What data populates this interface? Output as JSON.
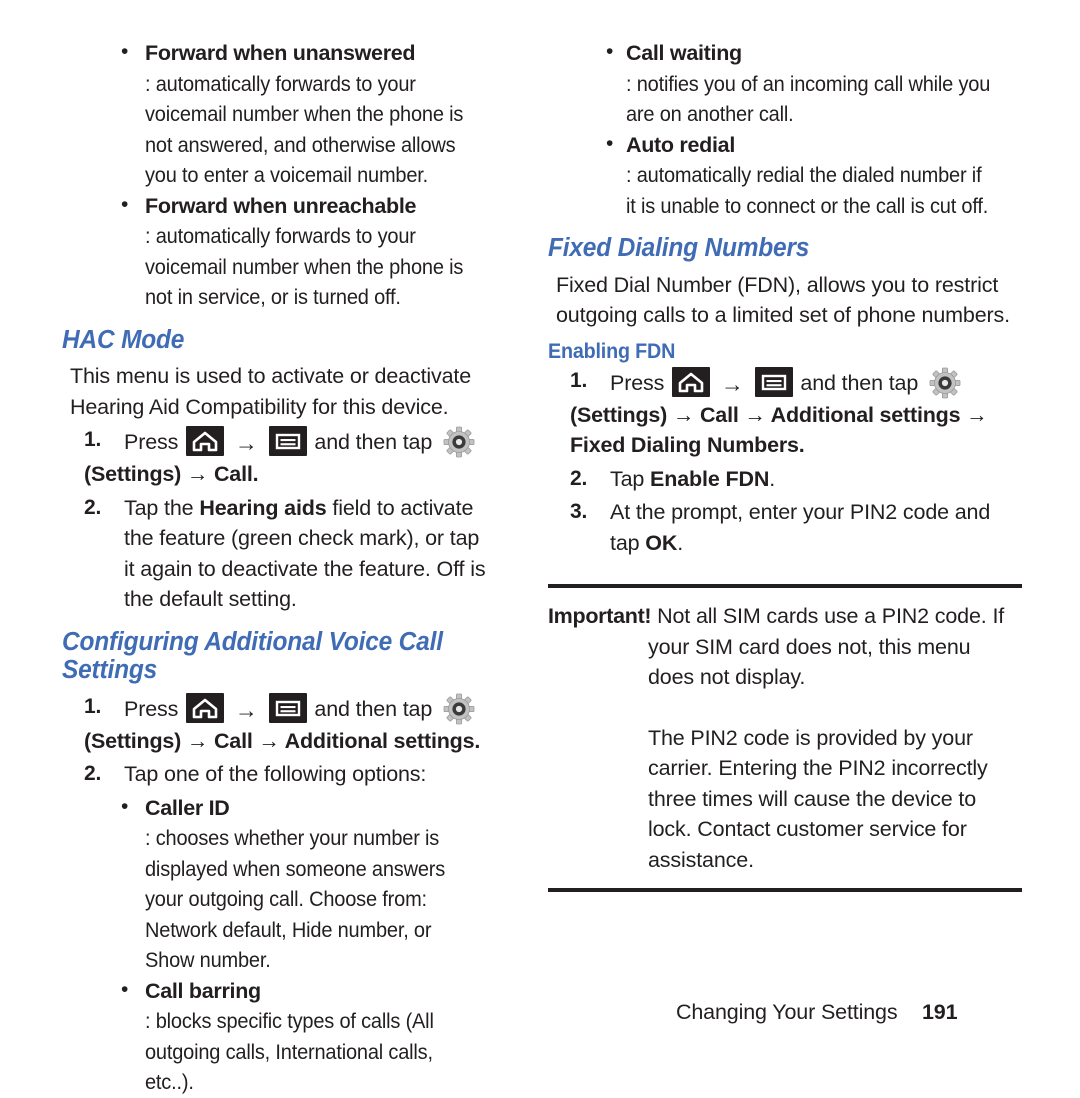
{
  "icons": {
    "home": "home-icon",
    "menu": "menu-icon",
    "gear": "gear-settings-icon",
    "arrow": "→"
  },
  "left_column": {
    "intro_bullets": [
      {
        "term": "Forward when unanswered",
        "text": ": automatically forwards to your voicemail number when the phone is not answered, and otherwise allows you to enter a voicemail number."
      },
      {
        "term": "Forward when unreachable",
        "text": ": automatically forwards to your voicemail number when the phone is not in service, or is turned off."
      }
    ],
    "hac": {
      "heading": "HAC Mode",
      "paragraph": "This menu is used to activate or deactivate Hearing Aid Compatibility for this device.",
      "step1": {
        "num": "1.",
        "press": "Press",
        "and_then_tap": "and then tap",
        "path": "(Settings) → Call."
      },
      "step2": {
        "num": "2.",
        "pre": "Tap the ",
        "bold": "Hearing aids",
        "post": " field to activate the feature (green check mark), or tap it again to deactivate the feature. Off is the default setting."
      }
    },
    "voice_call": {
      "heading": "Configuring Additional Voice Call Settings",
      "step1": {
        "num": "1.",
        "press": "Press",
        "and_then_tap": "and then tap",
        "path": "(Settings) → Call → Additional settings."
      },
      "step2": {
        "num": "2.",
        "text": "Tap one of the following options:"
      },
      "options": [
        {
          "term": "Caller ID",
          "text": ": chooses whether your number is displayed when someone answers your outgoing call. Choose from: Network default, Hide number, or Show number."
        },
        {
          "term": "Call barring",
          "text": ": blocks specific types of calls (All outgoing calls, International calls, etc..)."
        }
      ]
    }
  },
  "right_column": {
    "top_bullets": [
      {
        "term": "Call waiting",
        "text": ": notifies you of an incoming call while you are on another call."
      },
      {
        "term": "Auto redial",
        "text": ": automatically redial the dialed number if it is unable to connect or the call is cut off."
      }
    ],
    "fdn": {
      "heading": "Fixed Dialing Numbers",
      "paragraph": "Fixed Dial Number (FDN), allows you to restrict outgoing calls to a limited set of phone numbers.",
      "sub_heading": "Enabling FDN",
      "step1": {
        "num": "1.",
        "press": "Press",
        "and_then_tap": "and then tap",
        "path_a": "(Settings) → Call  → Additional settings →",
        "path_b": "Fixed Dialing Numbers."
      },
      "step2": {
        "num": "2.",
        "pre": "Tap ",
        "bold": "Enable FDN",
        "post": "."
      },
      "step3": {
        "num": "3.",
        "pre": "At the prompt, enter your PIN2 code and tap ",
        "bold": "OK",
        "post": "."
      }
    },
    "note": {
      "label": "Important!",
      "paragraph1": "Not all SIM cards use a PIN2 code. If your SIM card does not, this menu does not display.",
      "paragraph2": "The PIN2 code is provided by your carrier. Entering the PIN2 incorrectly three times will cause the device to lock. Contact customer service for assistance."
    }
  },
  "footer": {
    "title": "Changing Your Settings",
    "page_number": "191"
  },
  "colors": {
    "heading_blue": "#3f6cb4",
    "body_text": "#231f20",
    "icon_black": "#231f20",
    "gear_gray": "#b8b8b8"
  }
}
